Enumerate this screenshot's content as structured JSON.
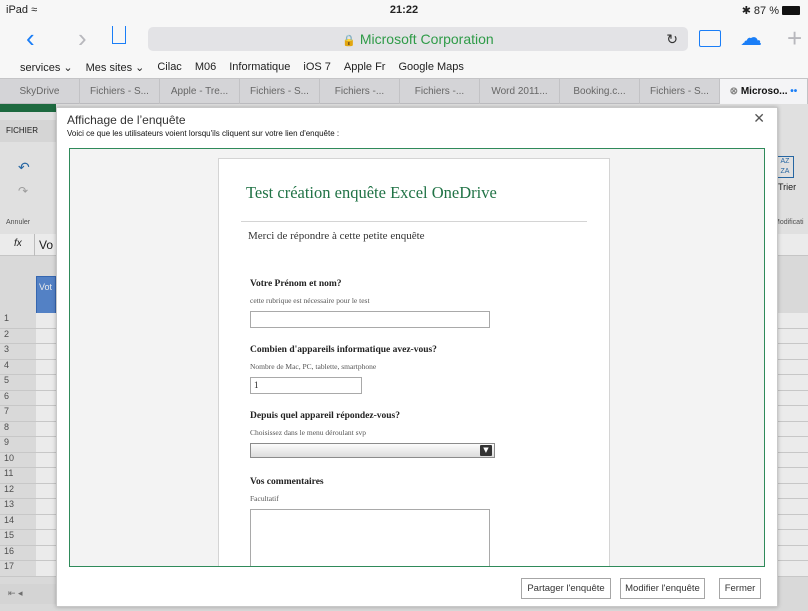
{
  "status": {
    "device": "iPad",
    "time": "21:22",
    "battery": "87 %"
  },
  "browser": {
    "url_title": "Microsoft Corporation",
    "bookmarks": [
      "services ⌄",
      "Mes sites ⌄",
      "Cilac",
      "M06",
      "Informatique",
      "iOS 7",
      "Apple Fr",
      "Google Maps"
    ],
    "tabs": [
      "SkyDrive",
      "Fichiers - S...",
      "Apple - Tre...",
      "Fichiers - S...",
      "Fichiers -...",
      "Fichiers -...",
      "Word 2011...",
      "Booking.c...",
      "Fichiers - S...",
      "Microso..."
    ]
  },
  "excel": {
    "file_tab": "FICHIER",
    "undo_label": "Annuler",
    "sort_label": "Trier",
    "modify_label": "Modificati",
    "fx": "fx",
    "cell_preview": "Vo",
    "col_header_cell": "Vot",
    "row_numbers": [
      "1",
      "2",
      "3",
      "4",
      "5",
      "6",
      "7",
      "8",
      "9",
      "10",
      "11",
      "12",
      "13",
      "14",
      "15",
      "16",
      "17"
    ]
  },
  "dialog": {
    "title": "Affichage de l’enquête",
    "subtitle": "Voici ce que les utilisateurs voient lorsqu'ils cliquent sur votre lien d'enquête :",
    "buttons": {
      "share": "Partager l'enquête",
      "modify": "Modifier l'enquête",
      "close": "Fermer"
    }
  },
  "survey": {
    "title": "Test création enquête Excel OneDrive",
    "description": "Merci de répondre à cette petite enquête",
    "q1": {
      "label": "Votre Prénom et nom?",
      "hint": "cette rubrique est nécessaire pour le test",
      "value": ""
    },
    "q2": {
      "label": "Combien d'appareils informatique avez-vous?",
      "hint": "Nombre de Mac, PC, tablette, smartphone",
      "value": "1"
    },
    "q3": {
      "label": "Depuis quel appareil répondez-vous?",
      "hint": "Choisissez dans le menu déroulant svp",
      "value": ""
    },
    "q4": {
      "label": "Vos commentaires",
      "hint": "Facultatif",
      "value": ""
    }
  },
  "colors": {
    "accent_green": "#217346",
    "ios_blue": "#1a7ef7",
    "url_green": "#2f9b48"
  }
}
